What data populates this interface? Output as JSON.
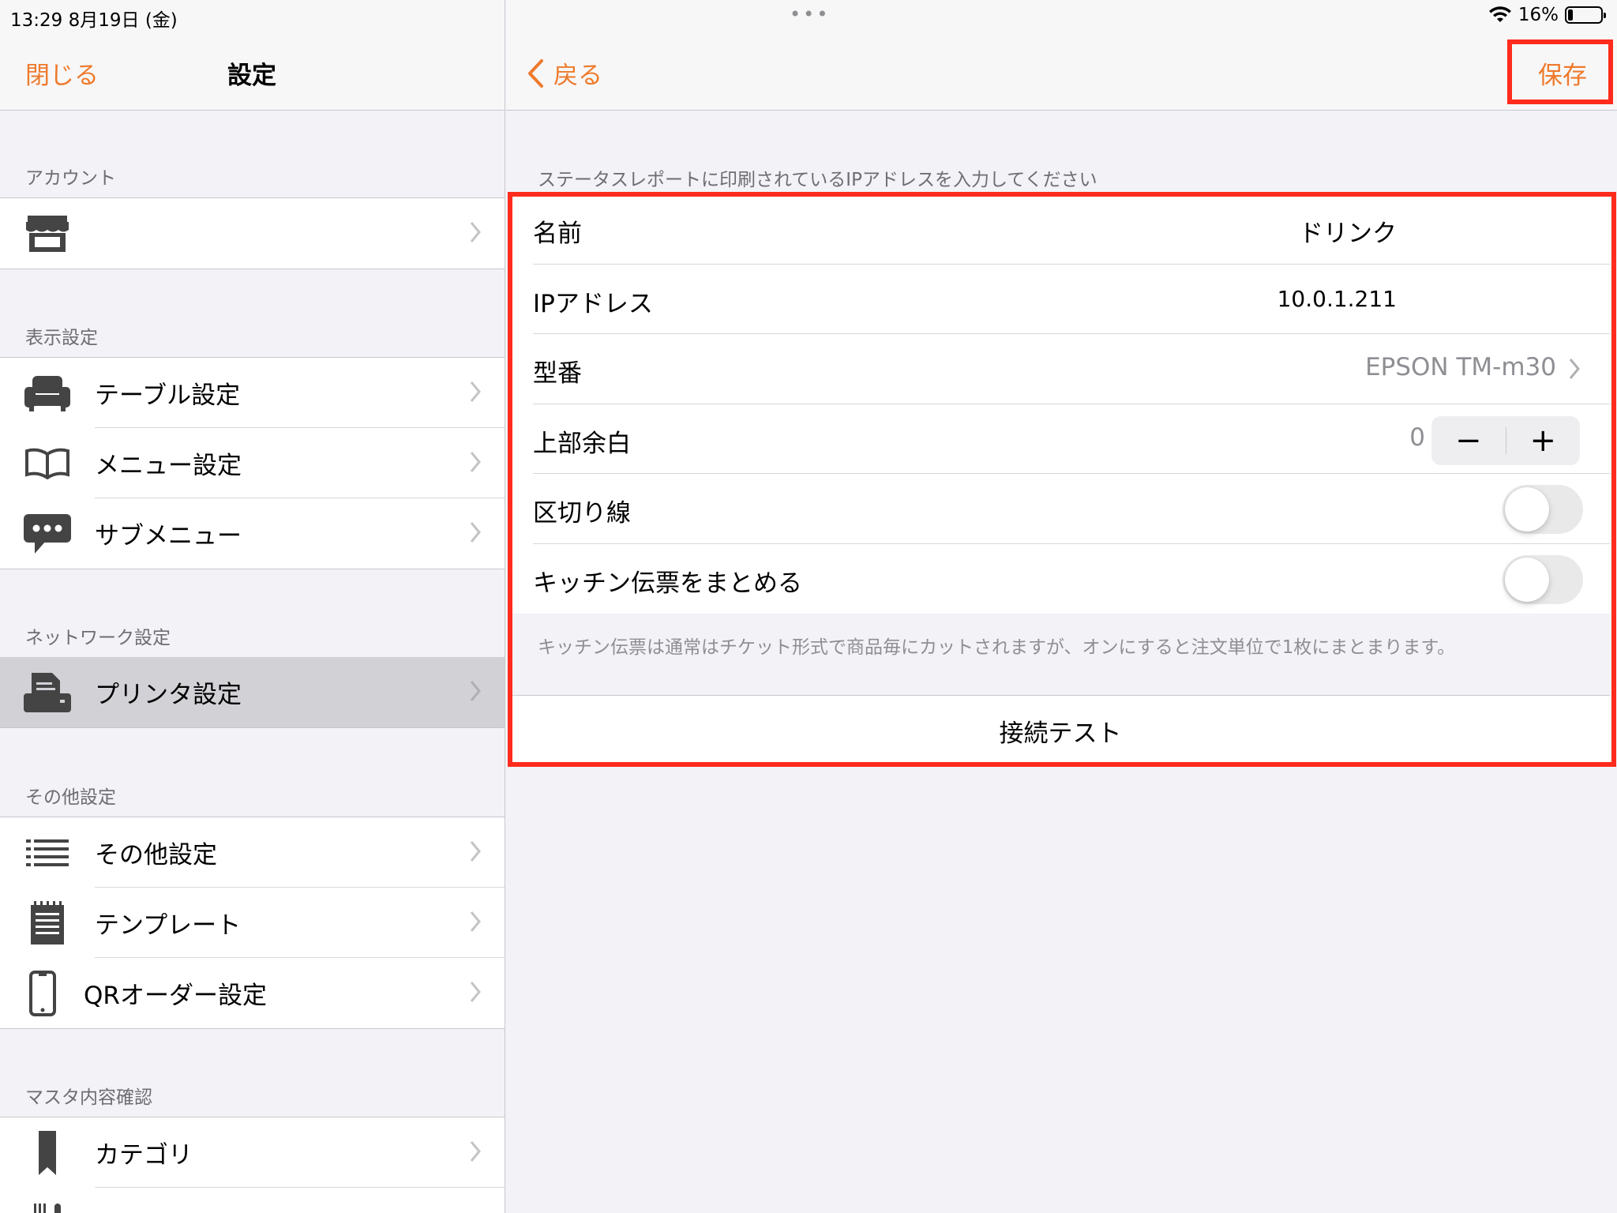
{
  "status_bar": {
    "time": "13:29",
    "date": "8月19日 (金)",
    "battery": "16%",
    "battery_level": 0.16
  },
  "sidebar": {
    "nav": {
      "close": "閉じる",
      "title": "設定"
    },
    "sections": [
      {
        "header": "アカウント",
        "items": [
          {
            "label": "",
            "icon": "storefront-icon"
          }
        ]
      },
      {
        "header": "表示設定",
        "items": [
          {
            "label": "テーブル設定",
            "icon": "sofa-icon"
          },
          {
            "label": "メニュー設定",
            "icon": "book-icon"
          },
          {
            "label": "サブメニュー",
            "icon": "chat-bubble-icon"
          }
        ]
      },
      {
        "header": "ネットワーク設定",
        "items": [
          {
            "label": "プリンタ設定",
            "icon": "printer-icon",
            "selected": true
          }
        ]
      },
      {
        "header": "その他設定",
        "items": [
          {
            "label": "その他設定",
            "icon": "list-icon"
          },
          {
            "label": "テンプレート",
            "icon": "notepad-icon"
          },
          {
            "label": "QRオーダー設定",
            "icon": "phone-icon"
          }
        ]
      },
      {
        "header": "マスタ内容確認",
        "items": [
          {
            "label": "カテゴリ",
            "icon": "bookmark-icon"
          }
        ]
      }
    ]
  },
  "detail": {
    "nav": {
      "back": "戻る",
      "save": "保存"
    },
    "hint": "ステータスレポートに印刷されているIPアドレスを入力してください",
    "fields": {
      "name": {
        "label": "名前",
        "value": "ドリンク"
      },
      "ip": {
        "label": "IPアドレス",
        "value": "10.0.1.211"
      },
      "model": {
        "label": "型番",
        "value": "EPSON TM-m30"
      },
      "top_margin": {
        "label": "上部余白",
        "value": "0",
        "minus": "−",
        "plus": "+"
      },
      "divider": {
        "label": "区切り線",
        "on": false
      },
      "combine": {
        "label": "キッチン伝票をまとめる",
        "on": false
      }
    },
    "note": "キッチン伝票は通常はチケット形式で商品毎にカットされますが、オンにすると注文単位で1枚にまとまります。",
    "test_button": "接続テスト"
  },
  "colors": {
    "accent": "#ee7a2d",
    "highlight": "#ff2b1c",
    "selected_row": "#d1d1d6"
  }
}
